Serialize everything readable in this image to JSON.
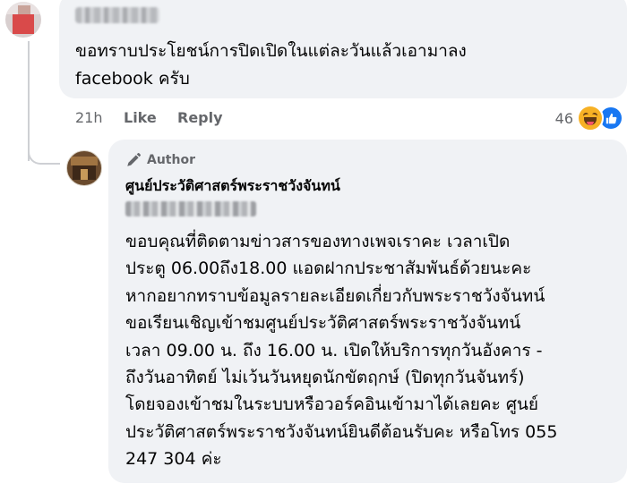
{
  "comment1": {
    "text_line1": "ขอทราบประโยชน์การปิดเปิดในแต่ละวันแล้วเอามาลง",
    "text_line2": "facebook ครับ",
    "time": "21h",
    "like_label": "Like",
    "reply_label": "Reply",
    "reaction_count": "46",
    "reaction_icons": [
      "haha-icon",
      "like-icon"
    ]
  },
  "comment2": {
    "author_badge": "Author",
    "page_name": "ศูนย์ประวัติศาสตร์พระราชวังจันทน์",
    "lines": [
      "ขอบคุณที่ติดตามข่าวสารของทางเพจเราคะ เวลาเปิด",
      "ประตู 06.00ถึง18.00 แอดฝากประชาสัมพันธ์ด้วยนะคะ",
      "หากอยากทราบข้อมูลรายละเอียดเกี่ยวกับพระราชวังจันทน์",
      "ขอเรียนเชิญเข้าชมศูนย์ประวัติศาสตร์พระราชวังจันทน์",
      "เวลา 09.00 น. ถึง 16.00 น. เปิดให้บริการทุกวันอังคาร -",
      "ถึงวันอาทิตย์ ไม่เว้นวันหยุดนักขัตฤกษ์ (ปิดทุกวันจันทร์)",
      "โดยจองเข้าชมในระบบหรือวอร์คอินเข้ามาได้เลยคะ ศูนย์",
      "ประวัติศาสตร์พระราชวังจันทน์ยินดีต้อนรับคะ หรือโทร 055",
      "247 304 ค่ะ"
    ]
  },
  "colors": {
    "bubble": "#f0f2f5",
    "meta_text": "#65676b",
    "like_blue": "#1877f2",
    "haha_yellow": "#f7b125"
  }
}
